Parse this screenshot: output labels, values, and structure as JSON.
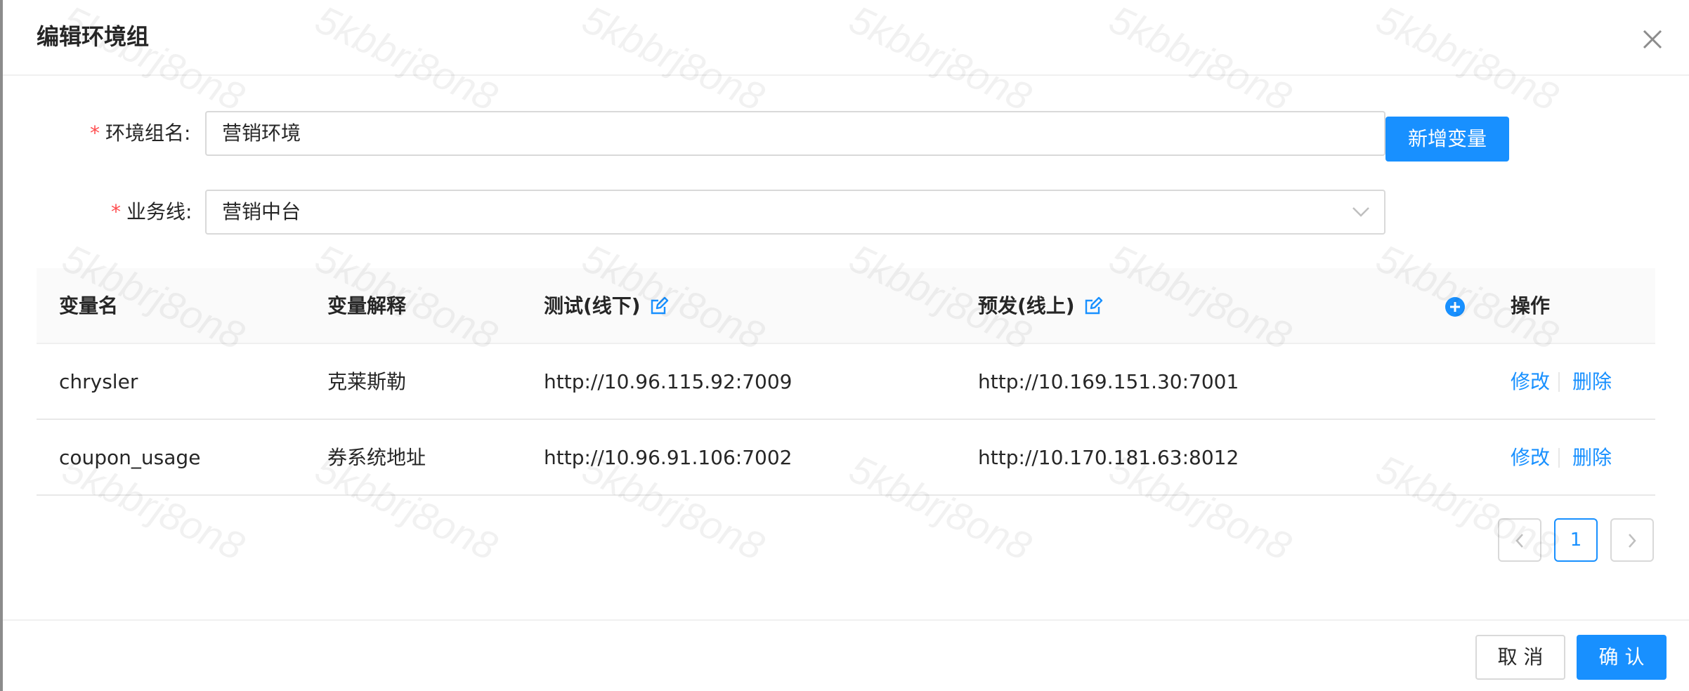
{
  "modal": {
    "title": "编辑环境组"
  },
  "form": {
    "group_name_label": "环境组名:",
    "group_name_required": "*",
    "group_name_value": "营销环境",
    "business_line_label": "业务线:",
    "business_line_required": "*",
    "business_line_value": "营销中台",
    "add_variable_label": "新增变量"
  },
  "table": {
    "headers": {
      "name": "变量名",
      "description": "变量解释",
      "test": "测试(线下)",
      "preview": "预发(线上)",
      "actions": "操作"
    },
    "rows": [
      {
        "name": "chrysler",
        "description": "克莱斯勒",
        "test": "http://10.96.115.92:7009",
        "preview": "http://10.169.151.30:7001",
        "edit": "修改",
        "delete": "删除"
      },
      {
        "name": "coupon_usage",
        "description": "券系统地址",
        "test": "http://10.96.91.106:7002",
        "preview": "http://10.170.181.63:8012",
        "edit": "修改",
        "delete": "删除"
      }
    ]
  },
  "pagination": {
    "current_page": "1"
  },
  "footer": {
    "cancel_label": "取 消",
    "confirm_label": "确 认"
  },
  "watermark": {
    "text": "5kbbrj8on8"
  },
  "colors": {
    "primary": "#1890ff",
    "required": "#ff4d4f",
    "header_bg": "#fafafa"
  }
}
